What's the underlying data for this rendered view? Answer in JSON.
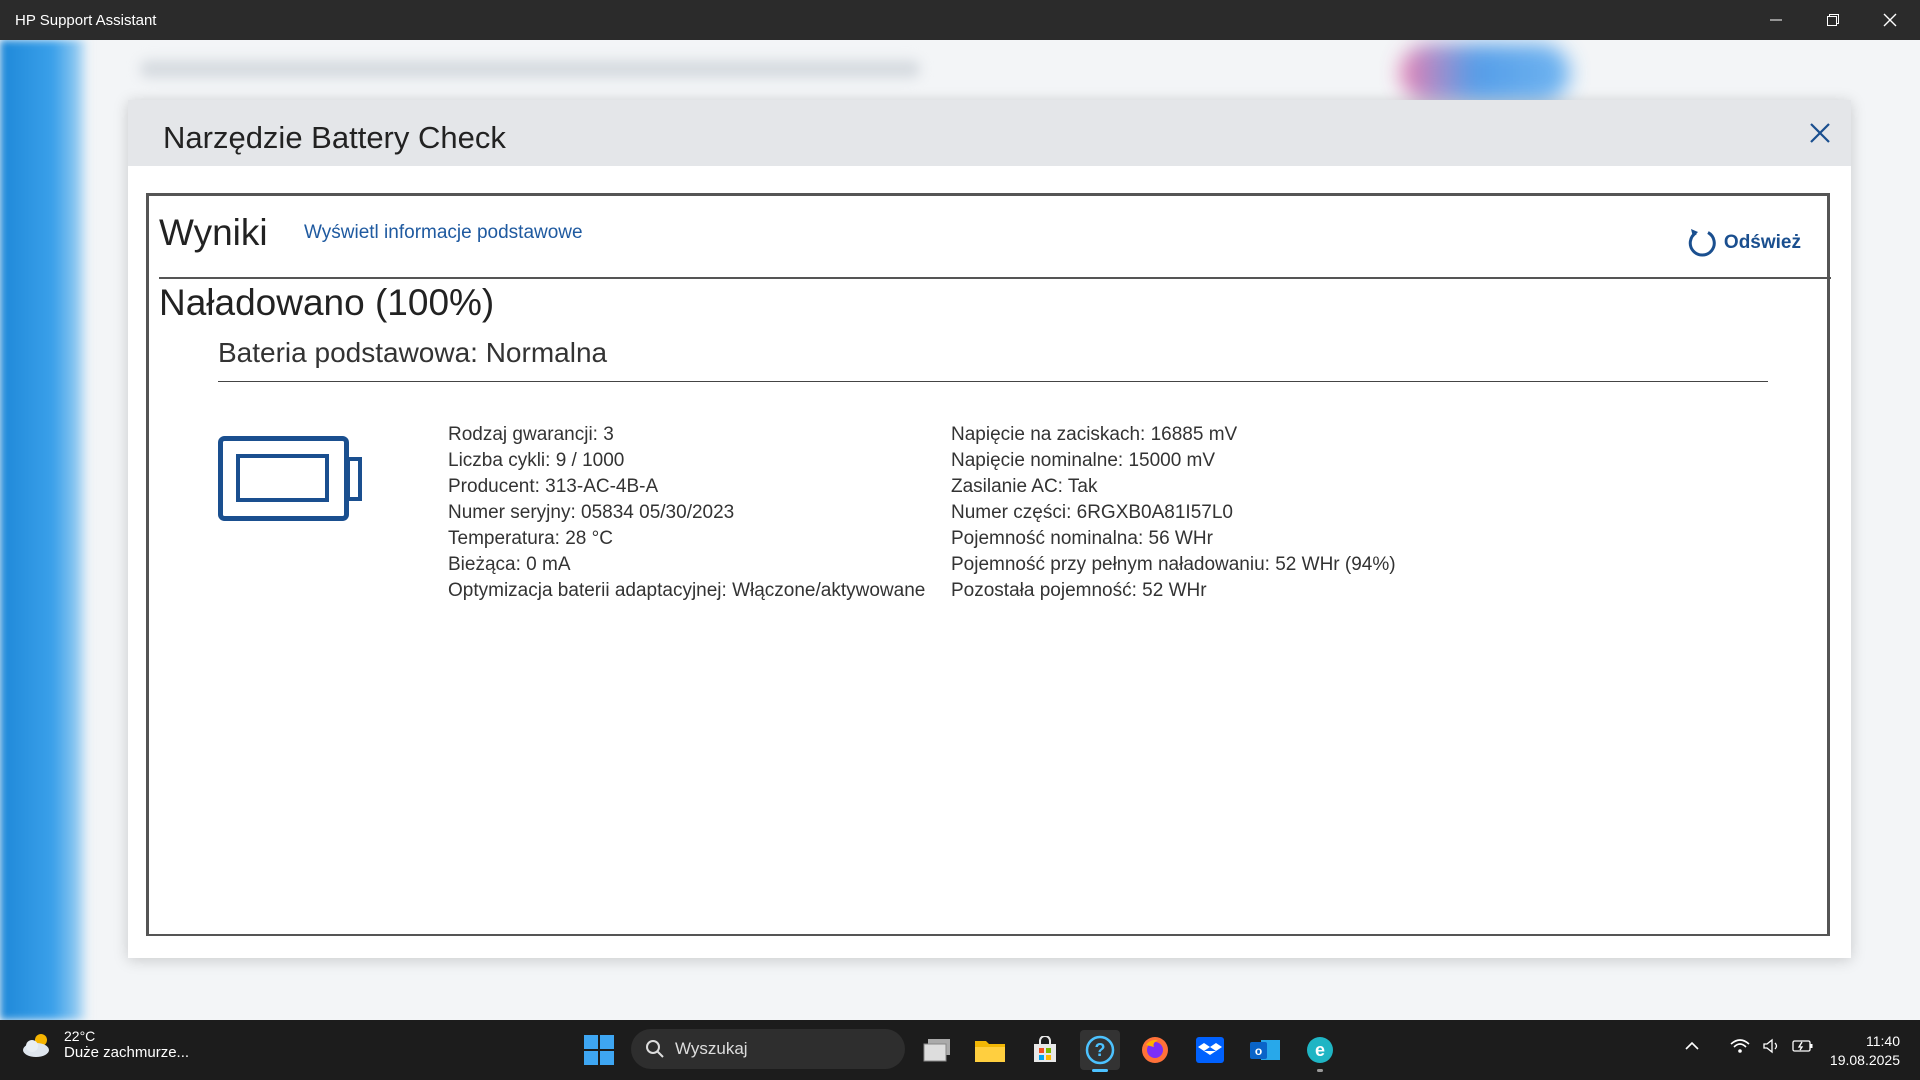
{
  "window": {
    "title": "HP Support Assistant"
  },
  "dialog": {
    "title": "Narzędzie Battery Check",
    "results_title": "Wyniki",
    "basic_info_link": "Wyświetl informacje podstawowe",
    "refresh_label": "Odśwież",
    "charge_status": "Naładowano (100%)",
    "battery_heading": "Bateria podstawowa: Normalna",
    "details_left": [
      "Rodzaj gwarancji: 3",
      "Liczba cykli: 9 / 1000",
      "Producent: 313-AC-4B-A",
      "Numer seryjny: 05834 05/30/2023",
      "Temperatura: 28 °C",
      "Bieżąca: 0 mA",
      "Optymizacja baterii adaptacyjnej: Włączone/aktywowane"
    ],
    "details_right": [
      "Napięcie na zaciskach: 16885 mV",
      "Napięcie nominalne: 15000 mV",
      "Zasilanie AC: Tak",
      "Numer części: 6RGXB0A81I57L0",
      "Pojemność nominalna: 56 WHr",
      "Pojemność przy pełnym naładowaniu: 52 WHr (94%)",
      "Pozostała pojemność: 52 WHr"
    ]
  },
  "taskbar": {
    "weather_temp": "22°C",
    "weather_desc": "Duże zachmurze...",
    "search_placeholder": "Wyszukaj",
    "clock_time": "11:40",
    "clock_date": "19.08.2025"
  },
  "colors": {
    "accent": "#1a4f8f",
    "link": "#1f5aa0",
    "titlebar": "#2b2b2b",
    "taskbar": "#1c1c1c"
  }
}
